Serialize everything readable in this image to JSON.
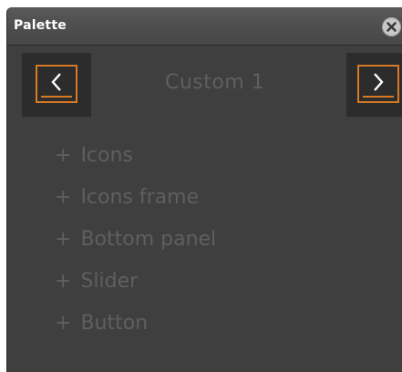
{
  "window": {
    "title": "Palette",
    "close_icon": "close-icon"
  },
  "navigator": {
    "prev_icon": "chevron-left-icon",
    "next_icon": "chevron-right-icon",
    "current_preset": "Custom 1"
  },
  "sections": [
    {
      "prefix": "+",
      "label": "Icons"
    },
    {
      "prefix": "+",
      "label": "Icons frame"
    },
    {
      "prefix": "+",
      "label": "Bottom panel"
    },
    {
      "prefix": "+",
      "label": "Slider"
    },
    {
      "prefix": "+",
      "label": "Button"
    }
  ],
  "colors": {
    "panel_bg": "#3f3f3f",
    "nav_bg": "#2c2c2c",
    "accent": "#d67a26",
    "muted_text": "#5f5f5f",
    "title_text": "#ffffff"
  }
}
